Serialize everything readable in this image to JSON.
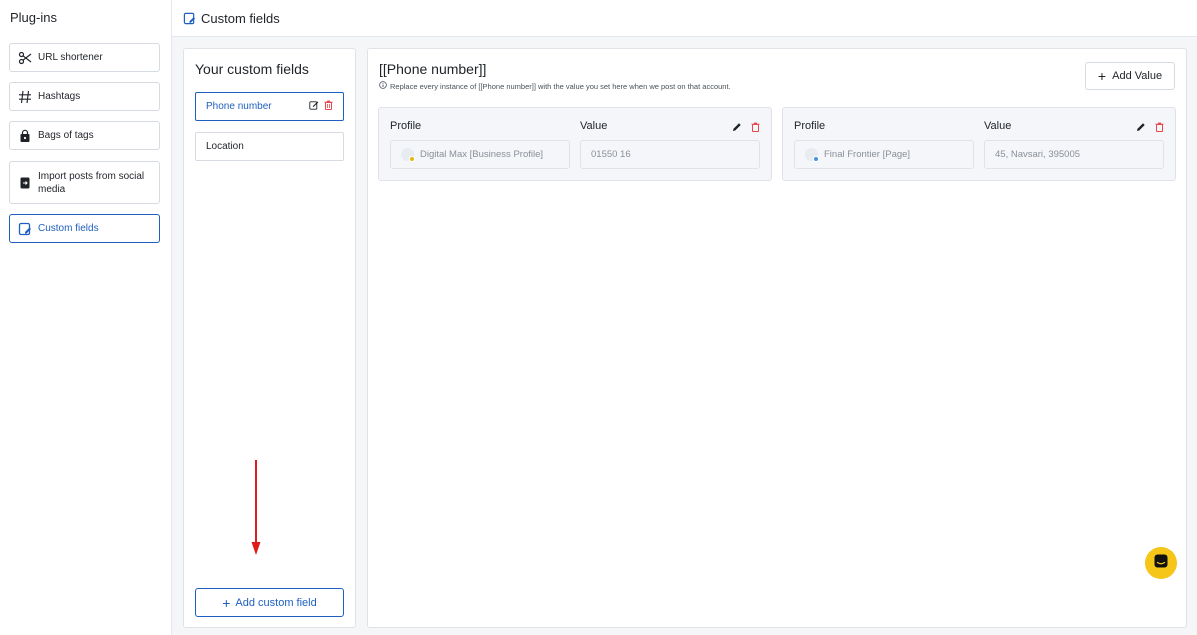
{
  "sidebar": {
    "title": "Plug-ins",
    "items": [
      {
        "label": "URL shortener",
        "icon": "scissors-icon"
      },
      {
        "label": "Hashtags",
        "icon": "hash-icon"
      },
      {
        "label": "Bags of tags",
        "icon": "bag-icon"
      },
      {
        "label": "Import posts from social media",
        "icon": "import-icon"
      },
      {
        "label": "Custom fields",
        "icon": "custom-fields-icon",
        "active": true
      }
    ]
  },
  "header": {
    "title": "Custom fields"
  },
  "fields_panel": {
    "title": "Your custom fields",
    "fields": [
      {
        "label": "Phone number",
        "active": true
      },
      {
        "label": "Location"
      }
    ],
    "add_button": "Add custom field"
  },
  "detail": {
    "title": "[[Phone number]]",
    "subtitle": "Replace every instance of [[Phone number]] with the value you set here when we post on that account.",
    "add_value_button": "Add Value",
    "profile_label": "Profile",
    "value_label": "Value",
    "cards": [
      {
        "profile": "Digital Max [Business Profile]",
        "value": "01550 16"
      },
      {
        "profile": "Final Frontier [Page]",
        "value": "45, Navsari, 395005"
      }
    ]
  },
  "colors": {
    "accent": "#1f5fbf",
    "danger": "#e5484d",
    "chat": "#f5c518",
    "annotation_arrow": "#e01b1b"
  }
}
